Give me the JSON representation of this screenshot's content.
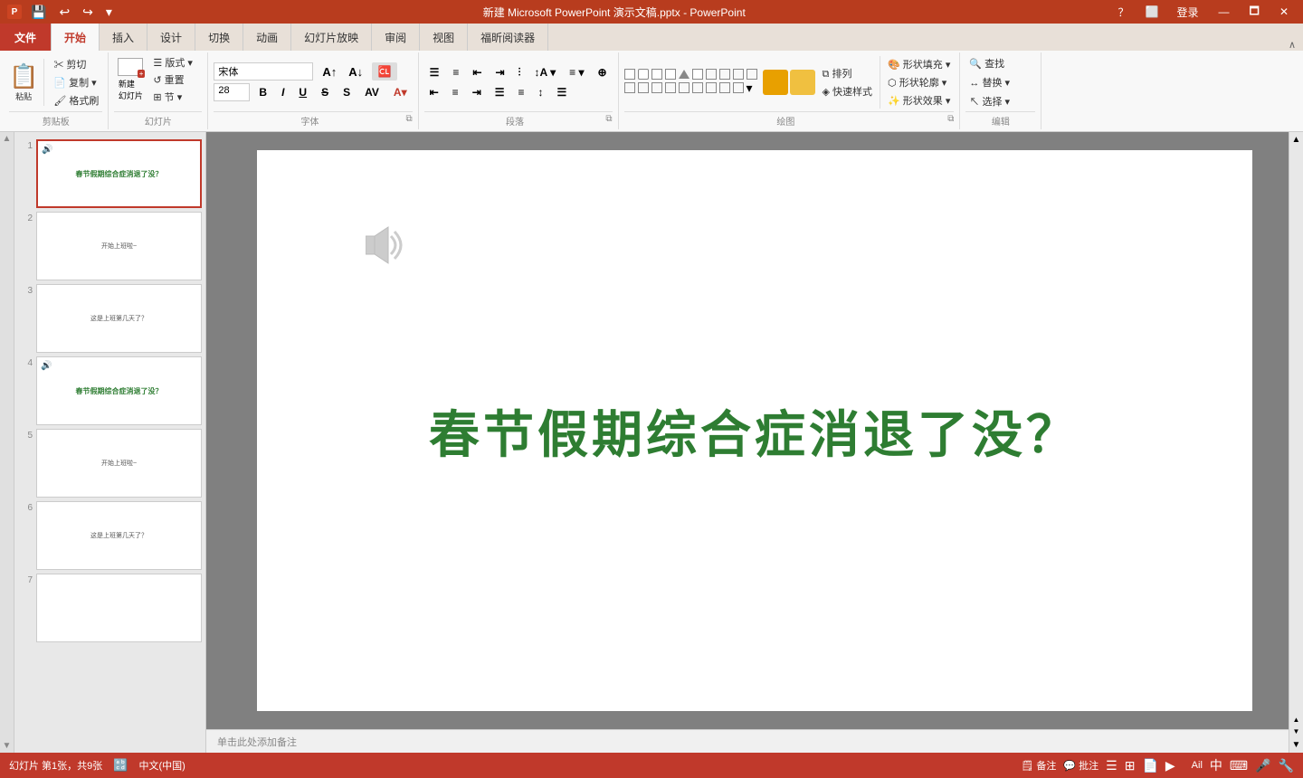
{
  "titleBar": {
    "title": "新建 Microsoft PowerPoint 演示文稿.pptx - PowerPoint",
    "quickAccess": [
      "💾",
      "↩",
      "↪",
      "⚙"
    ],
    "winButtons": [
      "？",
      "⬜",
      "—",
      "🗖",
      "✕"
    ],
    "loginLabel": "登录"
  },
  "tabs": [
    {
      "label": "文件",
      "id": "tab-file",
      "active": false,
      "isFile": true
    },
    {
      "label": "开始",
      "id": "tab-home",
      "active": true
    },
    {
      "label": "插入",
      "id": "tab-insert",
      "active": false
    },
    {
      "label": "设计",
      "id": "tab-design",
      "active": false
    },
    {
      "label": "切换",
      "id": "tab-transition",
      "active": false
    },
    {
      "label": "动画",
      "id": "tab-animation",
      "active": false
    },
    {
      "label": "幻灯片放映",
      "id": "tab-slideshow",
      "active": false
    },
    {
      "label": "审阅",
      "id": "tab-review",
      "active": false
    },
    {
      "label": "视图",
      "id": "tab-view",
      "active": false
    },
    {
      "label": "福昕阅读器",
      "id": "tab-foxit",
      "active": false
    }
  ],
  "ribbon": {
    "groups": [
      {
        "label": "剪贴板",
        "id": "grp-clipboard"
      },
      {
        "label": "幻灯片",
        "id": "grp-slides"
      },
      {
        "label": "字体",
        "id": "grp-font"
      },
      {
        "label": "段落",
        "id": "grp-paragraph"
      },
      {
        "label": "绘图",
        "id": "grp-drawing"
      },
      {
        "label": "编辑",
        "id": "grp-editing"
      }
    ]
  },
  "slides": [
    {
      "number": "1",
      "active": true,
      "hasSound": true,
      "content": "春节假期综合症消退了没？",
      "type": "title"
    },
    {
      "number": "2",
      "active": false,
      "hasSound": false,
      "content": "开始上班啦~",
      "type": "content"
    },
    {
      "number": "3",
      "active": false,
      "hasSound": false,
      "content": "这是上班第几天了？",
      "type": "content"
    },
    {
      "number": "4",
      "active": false,
      "hasSound": true,
      "content": "春节假期综合症消退了没？",
      "type": "title"
    },
    {
      "number": "5",
      "active": false,
      "hasSound": false,
      "content": "开始上班啦~",
      "type": "content"
    },
    {
      "number": "6",
      "active": false,
      "hasSound": false,
      "content": "这是上班第几天了？",
      "type": "content"
    },
    {
      "number": "7",
      "active": false,
      "hasSound": false,
      "content": "",
      "type": "blank"
    }
  ],
  "mainSlide": {
    "title": "春节假期综合症消退了没？",
    "notes": "单击此处添加备注"
  },
  "statusBar": {
    "slideInfo": "幻灯片 第1张，共9张",
    "spellingIcon": "🔠",
    "language": "中文(中国)",
    "notes": "备注",
    "comments": "批注",
    "viewButtons": [
      "☰",
      "▣",
      "▤",
      "⊞"
    ],
    "zoomLevel": "Ail"
  }
}
